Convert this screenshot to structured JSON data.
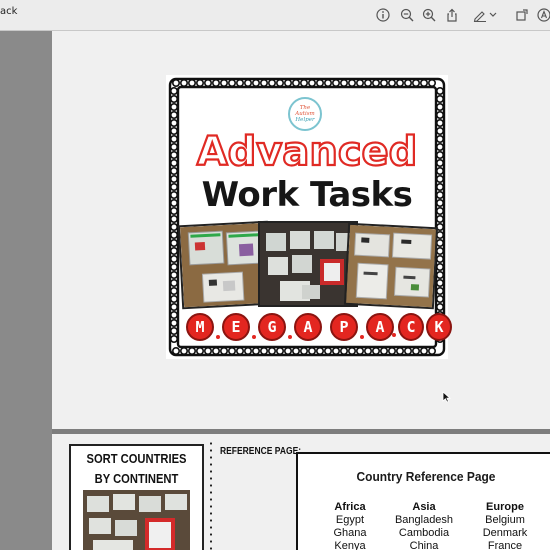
{
  "window": {
    "title_fragment": "ack"
  },
  "toolbar": {
    "icons": [
      "info-icon",
      "zoom-out-icon",
      "zoom-in-icon",
      "share-icon",
      "markup-pen-icon",
      "chevron-down-icon",
      "rotate-icon",
      "markup-toolbar-icon"
    ]
  },
  "cover": {
    "logo_text": [
      "The Autism",
      "Helper"
    ],
    "title_line1": "Advanced",
    "title_line2": "Work Tasks",
    "mega_letters": [
      "M",
      "E",
      "G",
      "A",
      "P",
      "A",
      "C",
      "K"
    ],
    "colors": {
      "accent_red": "#e02a24",
      "frame": "#111111"
    }
  },
  "page2": {
    "sort_title_line1": "SORT COUNTRIES",
    "sort_title_line2": "BY CONTINENT",
    "reference_label": "REFERENCE PAGE:",
    "reference": {
      "title": "Country Reference Page",
      "columns": [
        {
          "heading": "Africa",
          "items": [
            "Egypt",
            "Ghana",
            "Kenya"
          ]
        },
        {
          "heading": "Asia",
          "items": [
            "Bangladesh",
            "Cambodia",
            "China"
          ]
        },
        {
          "heading": "Europe",
          "items": [
            "Belgium",
            "Denmark",
            "France"
          ]
        }
      ]
    }
  }
}
